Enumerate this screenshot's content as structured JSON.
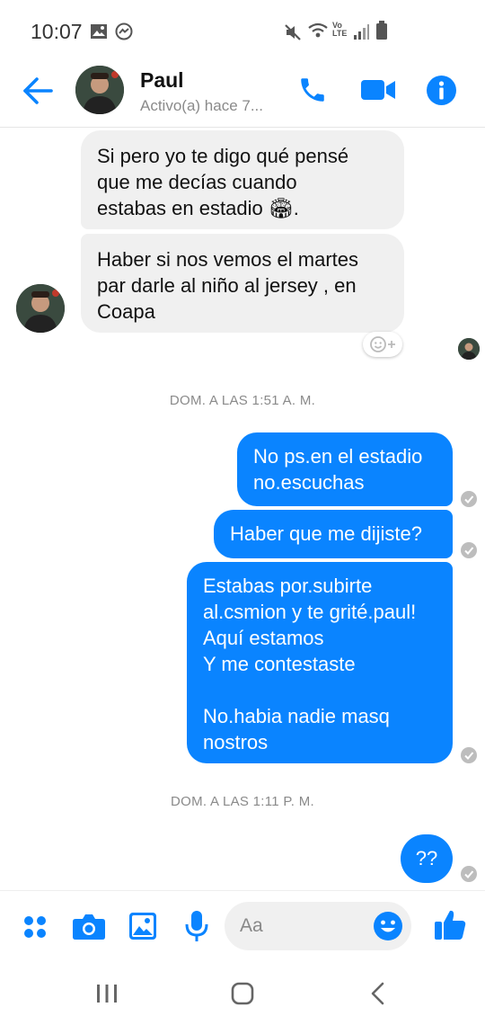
{
  "status_bar": {
    "time": "10:07"
  },
  "header": {
    "contact_name": "Paul",
    "contact_status": "Activo(a) hace 7..."
  },
  "messages": [
    {
      "from": "contact",
      "text": "Si pero yo te digo qué pensé\nque me decías cuando\nestabas en estadio 🏟."
    },
    {
      "from": "contact",
      "text": "Haber si nos vemos el martes\npar darle al niño al jersey , en\nCoapa"
    },
    {
      "type": "date",
      "text": "DOM. A LAS 1:51 A. M."
    },
    {
      "from": "me",
      "text": "No ps.en el estadio\nno.escuchas"
    },
    {
      "from": "me",
      "text": "Haber que me dijiste?"
    },
    {
      "from": "me",
      "text": "Estabas por.subirte\nal.csmion y te grité.paul!\nAquí estamos\nY me contestaste\n\nNo.habia nadie masq\nnostros"
    },
    {
      "type": "date",
      "text": "DOM. A LAS 1:11 P. M."
    },
    {
      "from": "me",
      "text": "??"
    }
  ],
  "composer": {
    "placeholder": "Aa"
  },
  "colors": {
    "accent": "#0a84ff",
    "incoming_bubble": "#f0f0f0",
    "outgoing_bubble": "#0a84ff"
  },
  "icons": {
    "header": [
      "back-arrow-icon",
      "phone-icon",
      "video-camera-icon",
      "info-icon"
    ],
    "composer": [
      "apps-icon",
      "camera-icon",
      "gallery-icon",
      "microphone-icon",
      "emoji-icon",
      "thumbs-up-icon"
    ],
    "navbar": [
      "recent-apps-icon",
      "home-icon",
      "back-icon"
    ]
  }
}
